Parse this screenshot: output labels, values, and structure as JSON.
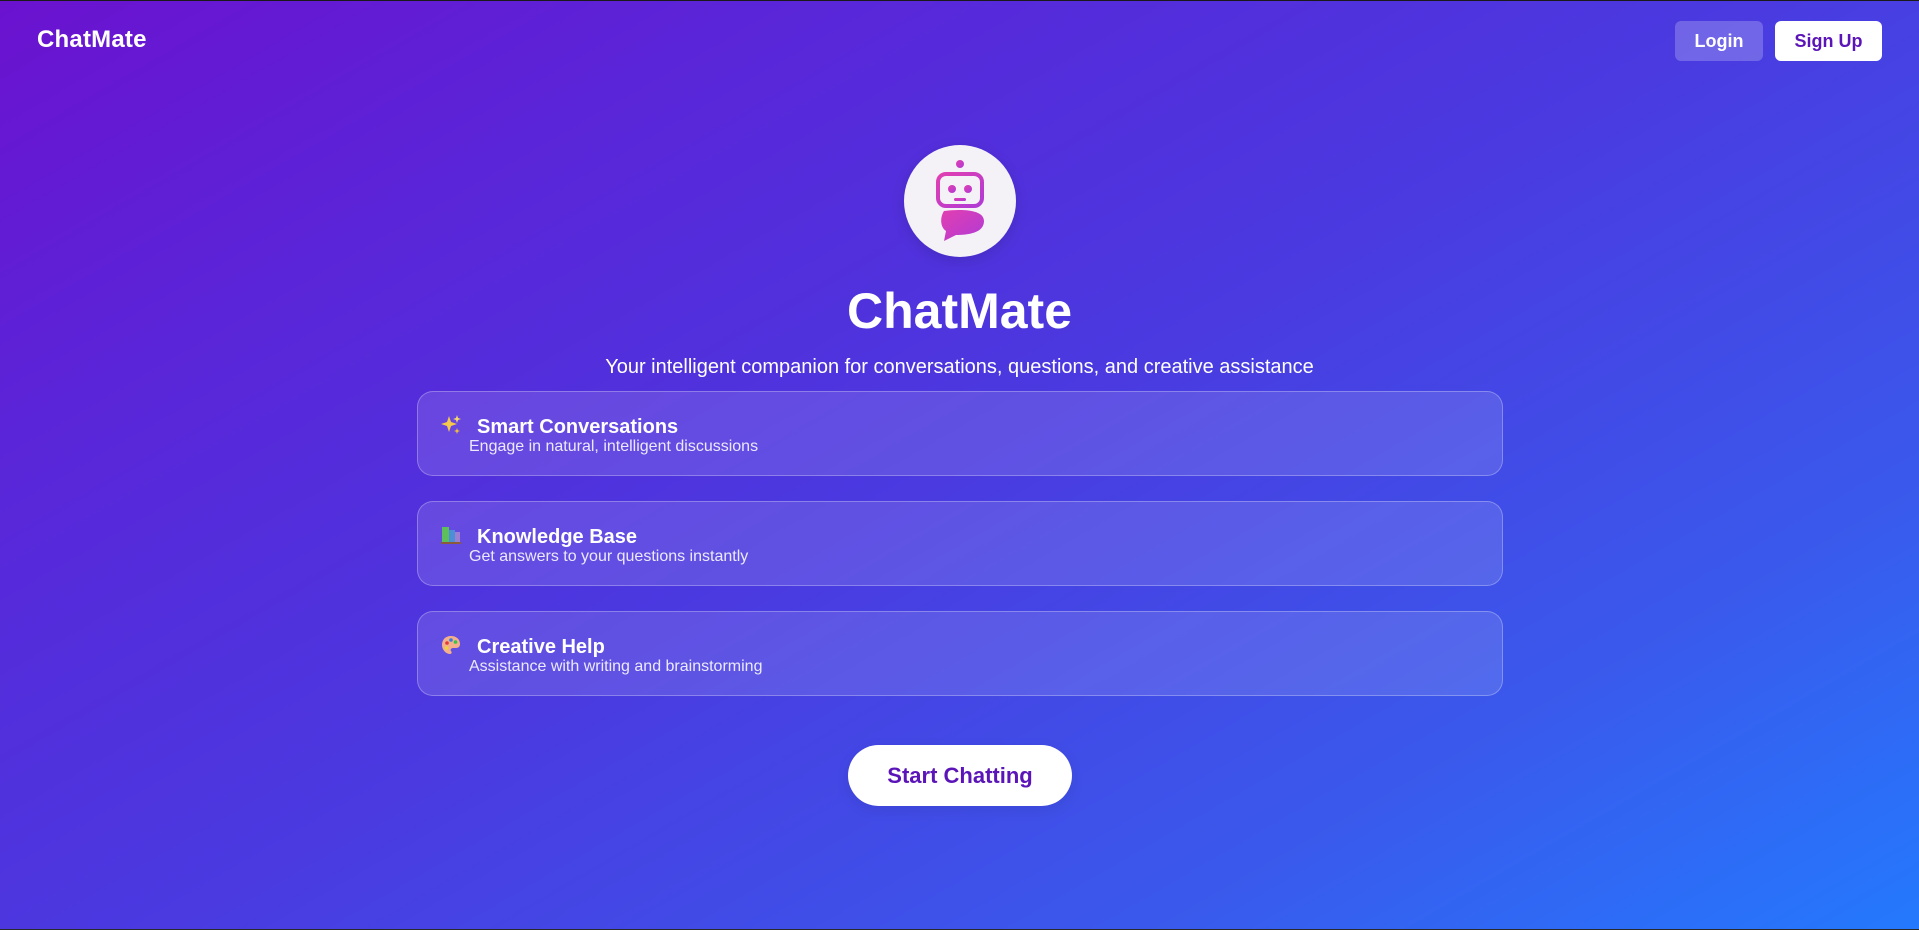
{
  "header": {
    "brand": "ChatMate",
    "login_label": "Login",
    "signup_label": "Sign Up"
  },
  "hero": {
    "logo_icon": "robot-chat-icon",
    "title": "ChatMate",
    "subtitle": "Your intelligent companion for conversations, questions, and creative assistance"
  },
  "features": [
    {
      "icon": "sparkles-icon",
      "title": "Smart Conversations",
      "description": "Engage in natural, intelligent discussions"
    },
    {
      "icon": "books-icon",
      "title": "Knowledge Base",
      "description": "Get answers to your questions instantly"
    },
    {
      "icon": "palette-icon",
      "title": "Creative Help",
      "description": "Assistance with writing and brainstorming"
    }
  ],
  "cta": {
    "label": "Start Chatting"
  },
  "colors": {
    "gradient_start": "#6b12cf",
    "gradient_end": "#2479fd",
    "accent_purple": "#5b14b8",
    "logo_pink": "#d63bb8"
  }
}
